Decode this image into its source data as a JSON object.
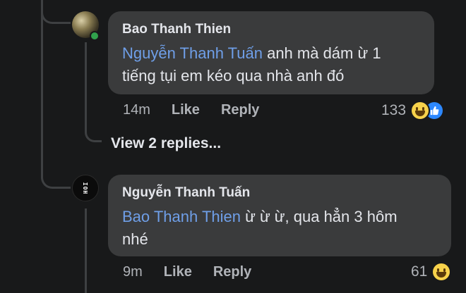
{
  "comments": [
    {
      "author": "Bao Thanh Thien",
      "mention": "Nguyễn Thanh Tuấn",
      "text_line1": " anh mà dám ừ 1",
      "text_line2": "tiếng tụi em kéo qua nhà anh đó",
      "time": "14m",
      "like_label": "Like",
      "reply_label": "Reply",
      "reaction_count": "133",
      "reactions": [
        "haha-emoji",
        "like-emoji"
      ]
    },
    {
      "author": "Nguyễn Thanh Tuấn",
      "mention": "Bao Thanh Thien",
      "text_line1": " ừ ừ ừ, qua hẳn 3 hôm",
      "text_line2": "nhé",
      "time": "9m",
      "like_label": "Like",
      "reply_label": "Reply",
      "reaction_count": "61",
      "reactions": [
        "haha-emoji"
      ],
      "avatar_text": "IOH"
    }
  ],
  "view_replies": "View 2 replies...",
  "colors": {
    "background": "#18191a",
    "bubble": "#3a3b3c",
    "mention": "#6f9fe8",
    "muted": "#b0b3b8",
    "online": "#31a24c",
    "like_blue": "#2d88ff"
  }
}
